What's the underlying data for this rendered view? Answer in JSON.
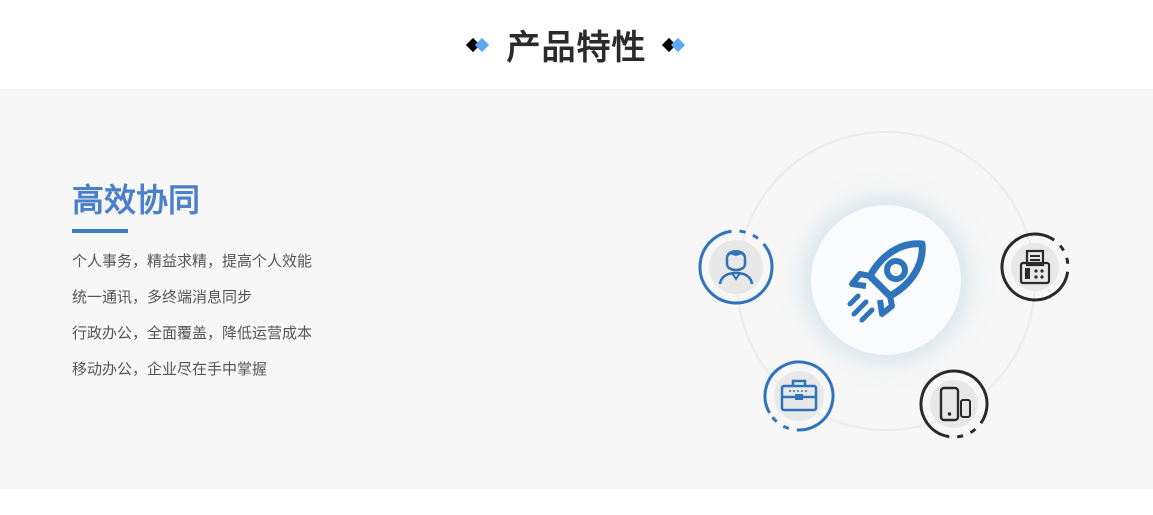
{
  "header": {
    "title": "产品特性"
  },
  "feature": {
    "title": "高效协同",
    "items": [
      "个人事务，精益求精，提高个人效能",
      "统一通讯，多终端消息同步",
      "行政办公，全面覆盖，降低运营成本",
      "移动办公，企业尽在手中掌握"
    ]
  },
  "diagram": {
    "center_icon": "rocket-icon",
    "nodes": [
      {
        "icon": "user-icon",
        "color": "#2f74bb"
      },
      {
        "icon": "fax-icon",
        "color": "#2a2a2a"
      },
      {
        "icon": "briefcase-icon",
        "color": "#2f74bb"
      },
      {
        "icon": "mobile-devices-icon",
        "color": "#2a2a2a"
      }
    ]
  },
  "colors": {
    "accent_blue": "#3a7bc8",
    "title_blue": "#4a7fc9",
    "deco_blue": "#5aa9f2",
    "band_bg": "#f7f7f7"
  }
}
